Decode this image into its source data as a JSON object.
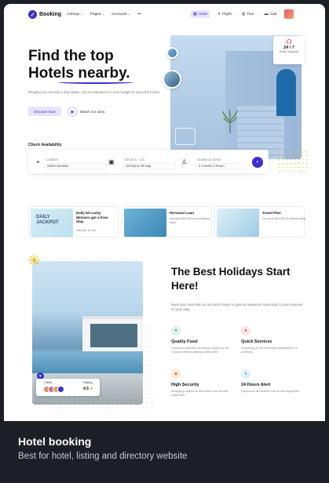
{
  "nav": {
    "logo": "Booking",
    "menu": [
      "Listings",
      "Pages",
      "Accounts"
    ],
    "more": "•••",
    "tabs": [
      {
        "label": "Hotel",
        "icon": "hotel-icon"
      },
      {
        "label": "Flight",
        "icon": "plane-icon"
      },
      {
        "label": "Tour",
        "icon": "globe-icon"
      },
      {
        "label": "Cab",
        "icon": "car-icon"
      }
    ]
  },
  "hero": {
    "title_line1": "Find the top",
    "title_line2": "Hotels nearby.",
    "description": "Bringing you not only a stay option, but an experience in your budget to enjoy the luxury.",
    "discover_label": "Discover Now",
    "watch_label": "Watch our story"
  },
  "support": {
    "title": "24 / 7",
    "subtitle": "Guide Supports"
  },
  "availability": {
    "label": "Check Availability",
    "location_label": "Location",
    "location_value": "Select location",
    "dates_label": "Check in - out",
    "dates_value": "19 Sep to 28 Sep",
    "guests_label": "Guests & rooms",
    "guests_value": "2 Guests 1 Room"
  },
  "promos": [
    {
      "title": "Daily 50 Lucky Winners get a Free Stay",
      "text": "Valid till: 15 Nov",
      "badge": "DAILY JACKPOT"
    },
    {
      "title": "Personal Loan",
      "text": "Get upto $50,000 at low interest rates"
    },
    {
      "title": "Travel Plan",
      "text": "Get up to $10,000 for Walkin funds"
    }
  ],
  "section": {
    "title": "The Best Holidays Start Here!",
    "description": "Book your hotel with us and don't forget to grab an awesome hotel deal to save massive on your stay.",
    "features": [
      {
        "title": "Quality Food",
        "text": "Departure defective arranging rapturous did. Conduct denied adding worthy little."
      },
      {
        "title": "Quick Services",
        "text": "Supposing so be resolving breakfast am or perfectly."
      },
      {
        "title": "High Security",
        "text": "Arranging rapturous did believe him all had supported."
      },
      {
        "title": "24 Hours Alert",
        "text": "Rapturous did believe him all had supported."
      }
    ],
    "client_label": "Client",
    "rating_label": "Rating",
    "rating_value": "4.5"
  },
  "footer": {
    "title": "Hotel booking",
    "subtitle": "Best for hotel, listing and directory website"
  },
  "colors": {
    "accent": "#3b2fd6",
    "background": "#1d1f26",
    "star": "#f2b60b"
  }
}
